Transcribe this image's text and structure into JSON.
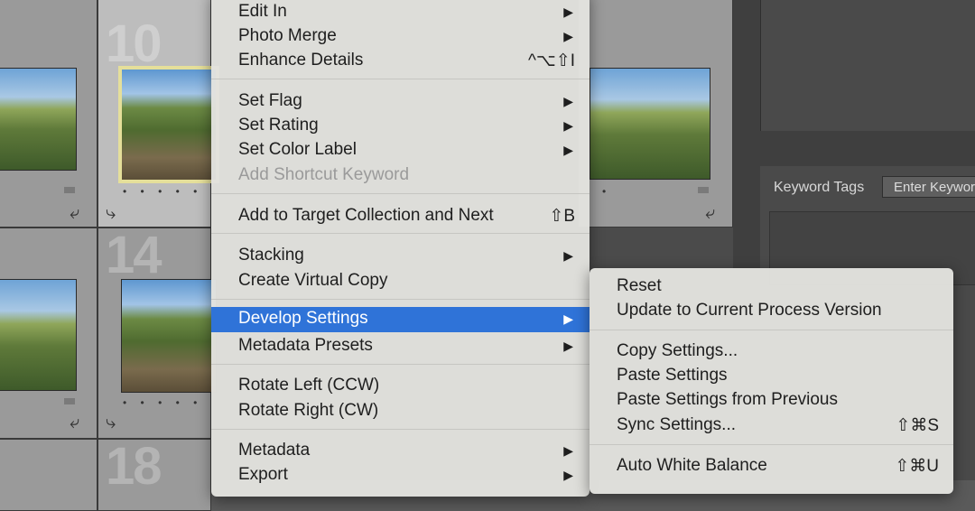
{
  "grid": {
    "cells": [
      {
        "number": "10"
      },
      {
        "number": "14"
      },
      {
        "number": "18"
      }
    ],
    "rating_dots": "• • • • •"
  },
  "panel": {
    "keyword_tags_label": "Keyword Tags",
    "keyword_input_placeholder": "Enter Keywords"
  },
  "context_menu": {
    "items": [
      {
        "label": "Edit In",
        "shortcut": "",
        "submenu": true
      },
      {
        "label": "Photo Merge",
        "shortcut": "",
        "submenu": true
      },
      {
        "label": "Enhance Details",
        "shortcut": "^⌥⇧I",
        "submenu": false
      },
      {
        "label": "Set Flag",
        "shortcut": "",
        "submenu": true
      },
      {
        "label": "Set Rating",
        "shortcut": "",
        "submenu": true
      },
      {
        "label": "Set Color Label",
        "shortcut": "",
        "submenu": true
      },
      {
        "label": "Add Shortcut Keyword",
        "shortcut": "",
        "submenu": false,
        "disabled": true
      },
      {
        "label": "Add to Target Collection and Next",
        "shortcut": "⇧B",
        "submenu": false
      },
      {
        "label": "Stacking",
        "shortcut": "",
        "submenu": true
      },
      {
        "label": "Create Virtual Copy",
        "shortcut": "",
        "submenu": false
      },
      {
        "label": "Develop Settings",
        "shortcut": "",
        "submenu": true,
        "highlighted": true
      },
      {
        "label": "Metadata Presets",
        "shortcut": "",
        "submenu": true
      },
      {
        "label": "Rotate Left (CCW)",
        "shortcut": "",
        "submenu": false
      },
      {
        "label": "Rotate Right (CW)",
        "shortcut": "",
        "submenu": false
      },
      {
        "label": "Metadata",
        "shortcut": "",
        "submenu": true
      },
      {
        "label": "Export",
        "shortcut": "",
        "submenu": true
      }
    ],
    "arrow": "▶"
  },
  "submenu": {
    "items": [
      {
        "label": "Reset",
        "shortcut": ""
      },
      {
        "label": "Update to Current Process Version",
        "shortcut": ""
      },
      {
        "label": "Copy Settings...",
        "shortcut": ""
      },
      {
        "label": "Paste Settings",
        "shortcut": ""
      },
      {
        "label": "Paste Settings from Previous",
        "shortcut": ""
      },
      {
        "label": "Sync Settings...",
        "shortcut": "⇧⌘S"
      },
      {
        "label": "Auto White Balance",
        "shortcut": "⇧⌘U"
      }
    ]
  },
  "colors": {
    "highlight": "#2f73d8",
    "menu_bg": "#e2e2de",
    "grid_cell": "#9a9a9a",
    "selected_cell": "#bdbdbd"
  }
}
